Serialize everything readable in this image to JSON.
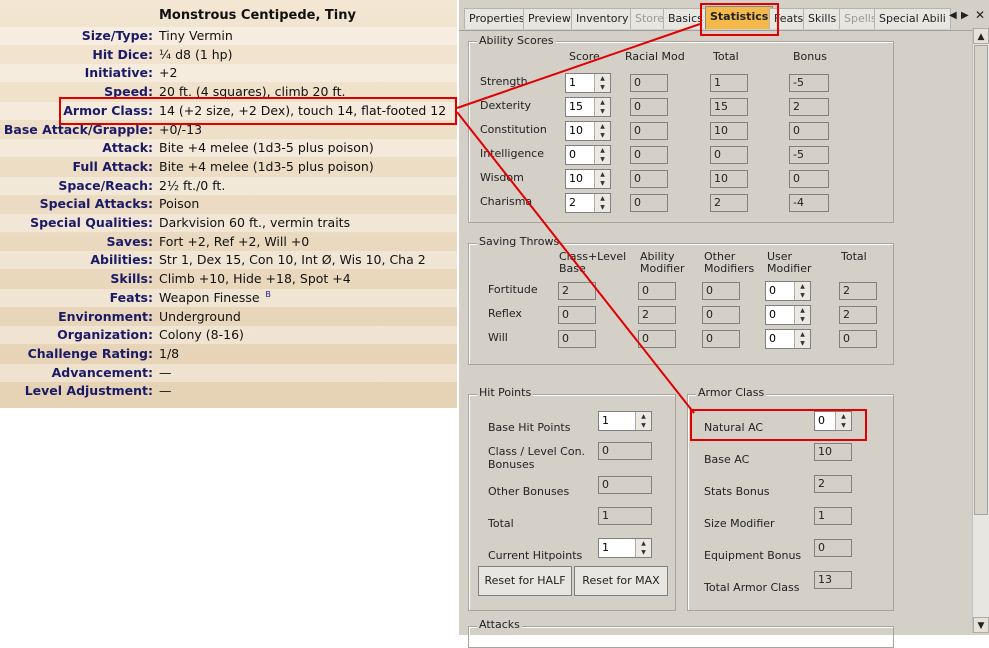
{
  "statblock": {
    "title": "Monstrous Centipede, Tiny",
    "rows": [
      {
        "label": "Size/Type:",
        "value": "Tiny Vermin"
      },
      {
        "label": "Hit Dice:",
        "value": "¼ d8 (1 hp)"
      },
      {
        "label": "Initiative:",
        "value": "+2"
      },
      {
        "label": "Speed:",
        "value": "20 ft. (4 squares), climb 20 ft."
      },
      {
        "label": "Armor Class:",
        "value": "14 (+2 size, +2 Dex), touch 14, flat-footed 12"
      },
      {
        "label": "Base Attack/Grapple:",
        "value": "+0/-13"
      },
      {
        "label": "Attack:",
        "value": "Bite +4 melee (1d3-5 plus poison)"
      },
      {
        "label": "Full Attack:",
        "value": "Bite +4 melee (1d3-5 plus poison)"
      },
      {
        "label": "Space/Reach:",
        "value": "2½ ft./0 ft."
      },
      {
        "label": "Special Attacks:",
        "value": "Poison"
      },
      {
        "label": "Special Qualities:",
        "value": "Darkvision 60 ft., vermin traits"
      },
      {
        "label": "Saves:",
        "value": "Fort +2, Ref +2, Will +0"
      },
      {
        "label": "Abilities:",
        "value": "Str 1, Dex 15, Con 10, Int Ø, Wis 10, Cha 2"
      },
      {
        "label": "Skills:",
        "value": "Climb +10, Hide +18, Spot +4"
      },
      {
        "label": "Feats:",
        "value": "Weapon Finesse",
        "sup": "B"
      },
      {
        "label": "Environment:",
        "value": "Underground"
      },
      {
        "label": "Organization:",
        "value": "Colony (8-16)"
      },
      {
        "label": "Challenge Rating:",
        "value": "1/8"
      },
      {
        "label": "Advancement:",
        "value": "—"
      },
      {
        "label": "Level Adjustment:",
        "value": "—"
      }
    ]
  },
  "tabs": [
    "Properties",
    "Preview",
    "Inventory",
    "Store",
    "Basics",
    "Statistics",
    "Feats",
    "Skills",
    "Spells",
    "Special Abili"
  ],
  "active_tab": "Statistics",
  "ability_scores": {
    "title": "Ability Scores",
    "headers": [
      "Score",
      "Racial Mod",
      "Total",
      "Bonus"
    ],
    "rows": [
      {
        "name": "Strength",
        "score": "1",
        "racial": "0",
        "total": "1",
        "bonus": "-5"
      },
      {
        "name": "Dexterity",
        "score": "15",
        "racial": "0",
        "total": "15",
        "bonus": "2"
      },
      {
        "name": "Constitution",
        "score": "10",
        "racial": "0",
        "total": "10",
        "bonus": "0"
      },
      {
        "name": "Intelligence",
        "score": "0",
        "racial": "0",
        "total": "0",
        "bonus": "-5"
      },
      {
        "name": "Wisdom",
        "score": "10",
        "racial": "0",
        "total": "10",
        "bonus": "0"
      },
      {
        "name": "Charisma",
        "score": "2",
        "racial": "0",
        "total": "2",
        "bonus": "-4"
      }
    ]
  },
  "saving_throws": {
    "title": "Saving Throws",
    "headers": [
      "Class+Level Base",
      "Ability Modifier",
      "Other Modifiers",
      "User Modifier",
      "Total"
    ],
    "rows": [
      {
        "name": "Fortitude",
        "base": "2",
        "ability": "0",
        "other": "0",
        "user": "0",
        "total": "2"
      },
      {
        "name": "Reflex",
        "base": "0",
        "ability": "2",
        "other": "0",
        "user": "0",
        "total": "2"
      },
      {
        "name": "Will",
        "base": "0",
        "ability": "0",
        "other": "0",
        "user": "0",
        "total": "0"
      }
    ]
  },
  "hit_points": {
    "title": "Hit Points",
    "base_label": "Base Hit Points",
    "base": "1",
    "con_label": "Class / Level Con. Bonuses",
    "con": "0",
    "other_label": "Other Bonuses",
    "other": "0",
    "total_label": "Total",
    "total": "1",
    "current_label": "Current Hitpoints",
    "current": "1",
    "reset_half": "Reset for HALF",
    "reset_max": "Reset for MAX"
  },
  "armor_class": {
    "title": "Armor Class",
    "natural_label": "Natural AC",
    "natural": "0",
    "base_label": "Base AC",
    "base": "10",
    "stats_label": "Stats Bonus",
    "stats": "2",
    "size_label": "Size Modifier",
    "size": "1",
    "equip_label": "Equipment Bonus",
    "equip": "0",
    "total_label": "Total Armor Class",
    "total": "13"
  },
  "attacks": {
    "title": "Attacks"
  },
  "colors": {
    "highlight": "#e00000",
    "active_tab": "#f5b94a"
  }
}
